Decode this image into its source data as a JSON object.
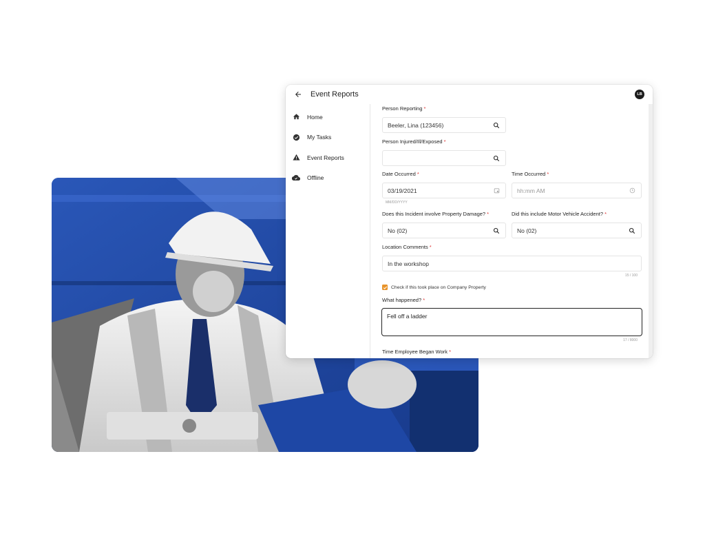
{
  "app": {
    "title": "Event Reports",
    "avatar_initials": "LB"
  },
  "sidebar": {
    "items": [
      {
        "label": "Home",
        "icon": "home-icon"
      },
      {
        "label": "My Tasks",
        "icon": "check-circle-icon"
      },
      {
        "label": "Event Reports",
        "icon": "warning-icon"
      },
      {
        "label": "Offline",
        "icon": "cloud-offline-icon"
      }
    ]
  },
  "form": {
    "person_reporting": {
      "label": "Person Reporting",
      "required": "*",
      "value": "Beeler, Lina (123456)"
    },
    "person_injured": {
      "label": "Person Injured/Ill/Exposed",
      "required": "*",
      "value": ""
    },
    "date_occurred": {
      "label": "Date Occurred",
      "required": "*",
      "value": "03/19/2021",
      "hint": "MM/DD/YYYY"
    },
    "time_occurred": {
      "label": "Time Occurred",
      "required": "*",
      "placeholder": "hh:mm AM"
    },
    "property_damage": {
      "label": "Does this Incident involve Property Damage?",
      "required": "*",
      "value": "No (02)"
    },
    "motor_vehicle": {
      "label": "Did this include Motor Vehicle Accident?",
      "required": "*",
      "value": "No (02)"
    },
    "location_comments": {
      "label": "Location Comments",
      "required": "*",
      "value": "In the workshop",
      "counter": "15 / 100"
    },
    "company_property": {
      "label": "Check if this took place on Company Property",
      "checked": true
    },
    "what_happened": {
      "label": "What happened?",
      "required": "*",
      "value": "Fell off a ladder",
      "counter": "17 / 8000"
    },
    "time_began_work": {
      "label": "Time Employee Began Work",
      "required": "*"
    }
  },
  "colors": {
    "accent_checkbox": "#e8942b",
    "photo_blue": "#1f4aa8",
    "required": "#dd3333"
  }
}
